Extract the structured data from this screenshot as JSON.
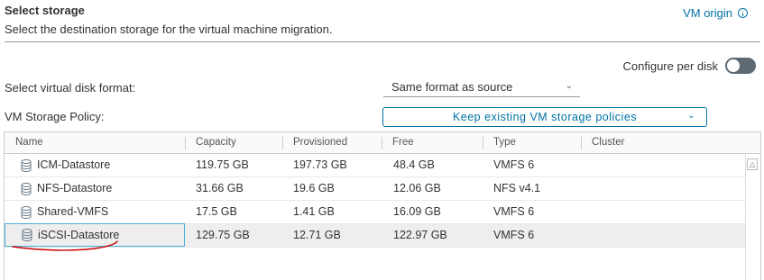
{
  "header": {
    "title": "Select storage",
    "subtitle": "Select the destination storage for the virtual machine migration.",
    "vm_origin_link": "VM origin"
  },
  "options": {
    "configure_per_disk_label": "Configure per disk",
    "configure_per_disk_on": false,
    "disk_format_label": "Select virtual disk format:",
    "disk_format_value": "Same format as source",
    "policy_label": "VM Storage Policy:",
    "policy_value": "Keep existing VM storage policies"
  },
  "table": {
    "columns": [
      "Name",
      "Capacity",
      "Provisioned",
      "Free",
      "Type",
      "Cluster"
    ],
    "rows": [
      {
        "name": "ICM-Datastore",
        "capacity": "119.75 GB",
        "provisioned": "197.73 GB",
        "free": "48.4 GB",
        "type": "VMFS 6",
        "cluster": ""
      },
      {
        "name": "NFS-Datastore",
        "capacity": "31.66 GB",
        "provisioned": "19.6 GB",
        "free": "12.06 GB",
        "type": "NFS v4.1",
        "cluster": ""
      },
      {
        "name": "Shared-VMFS",
        "capacity": "17.5 GB",
        "provisioned": "1.41 GB",
        "free": "16.09 GB",
        "type": "VMFS 6",
        "cluster": ""
      },
      {
        "name": "iSCSI-Datastore",
        "capacity": "129.75 GB",
        "provisioned": "12.71 GB",
        "free": "122.97 GB",
        "type": "VMFS 6",
        "cluster": ""
      }
    ],
    "selected_row": 3
  },
  "colors": {
    "link": "#0072a3",
    "selection_border": "#49afd9",
    "annotation": "#cc0000"
  },
  "icons": {
    "datastore": "database-icon",
    "info": "info-icon",
    "scroll_up": "scroll-up-arrow-icon"
  }
}
